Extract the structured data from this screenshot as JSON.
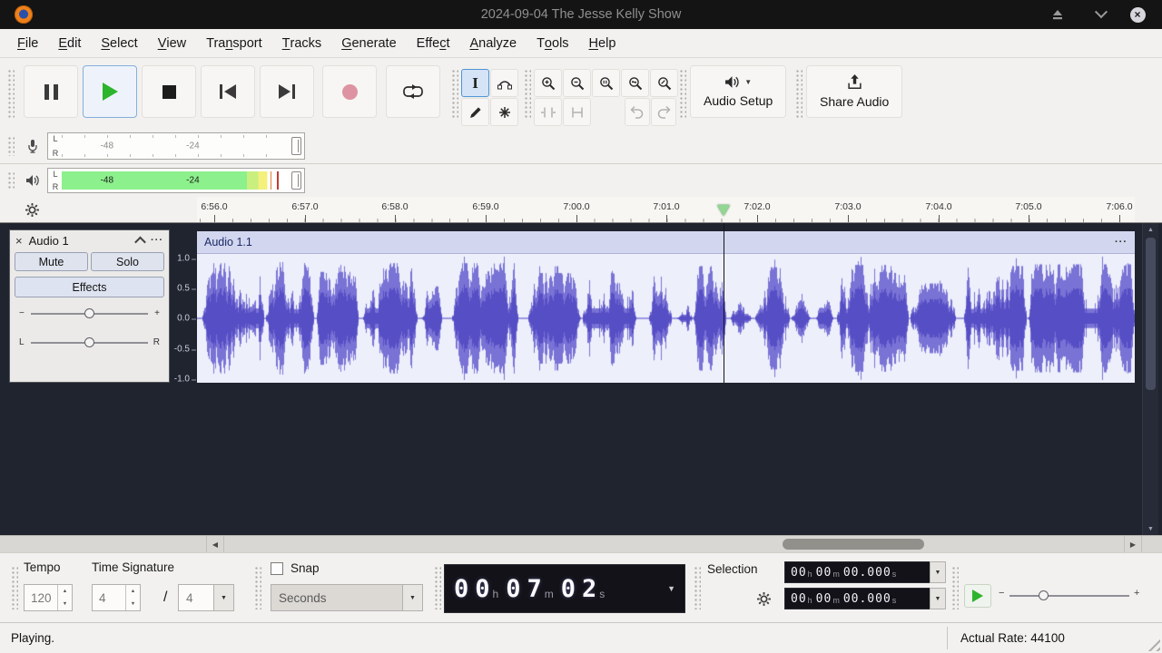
{
  "window": {
    "title": "2024-09-04 The Jesse Kelly Show"
  },
  "menu": {
    "items": [
      {
        "pre": "",
        "key": "F",
        "post": "ile"
      },
      {
        "pre": "",
        "key": "E",
        "post": "dit"
      },
      {
        "pre": "",
        "key": "S",
        "post": "elect"
      },
      {
        "pre": "",
        "key": "V",
        "post": "iew"
      },
      {
        "pre": "Tra",
        "key": "n",
        "post": "sport"
      },
      {
        "pre": "",
        "key": "T",
        "post": "racks"
      },
      {
        "pre": "",
        "key": "G",
        "post": "enerate"
      },
      {
        "pre": "Effe",
        "key": "c",
        "post": "t"
      },
      {
        "pre": "",
        "key": "A",
        "post": "nalyze"
      },
      {
        "pre": "T",
        "key": "o",
        "post": "ols"
      },
      {
        "pre": "",
        "key": "H",
        "post": "elp"
      }
    ]
  },
  "toolbar": {
    "audio_setup_label": "Audio Setup",
    "share_audio_label": "Share Audio"
  },
  "meters": {
    "record": {
      "l": "L",
      "r": "R"
    },
    "playback": {
      "l": "L",
      "r": "R"
    },
    "scale": [
      "-48",
      "-24"
    ]
  },
  "timeline": {
    "ticks": [
      "6:56.0",
      "6:57.0",
      "6:58.0",
      "6:59.0",
      "7:00.0",
      "7:01.0",
      "7:02.0",
      "7:03.0",
      "7:04.0",
      "7:05.0",
      "7:06.0"
    ]
  },
  "track": {
    "name": "Audio 1",
    "mute_label": "Mute",
    "solo_label": "Solo",
    "effects_label": "Effects",
    "gain_min": "−",
    "gain_max": "+",
    "pan_left": "L",
    "pan_right": "R",
    "scale": [
      "1.0",
      "0.5",
      "0.0",
      "-0.5",
      "-1.0"
    ],
    "clip_name": "Audio 1.1"
  },
  "transport_time": {
    "h": "00",
    "unit_h": "h",
    "m": "07",
    "unit_m": "m",
    "s": "02",
    "unit_s": "s"
  },
  "selection": {
    "label": "Selection",
    "units": {
      "h": "h",
      "m": "m",
      "s": "s"
    },
    "rows": [
      {
        "h": "00",
        "m": "00",
        "s": "00.000"
      },
      {
        "h": "00",
        "m": "00",
        "s": "00.000"
      }
    ]
  },
  "bottom": {
    "tempo_label": "Tempo",
    "tempo_value": "120",
    "timesig_label": "Time Signature",
    "timesig_upper": "4",
    "timesig_divider": "/",
    "timesig_lower": "4",
    "snap_label": "Snap",
    "snap_value": "Seconds"
  },
  "status": {
    "left": "Playing.",
    "right": "Actual Rate: 44100"
  },
  "icons": {
    "caret_down": "▼",
    "caret_up": "▲",
    "arrow_left": "◀",
    "arrow_right": "▶",
    "ellipsis": "···",
    "close_track": "×",
    "titlebar_close": "×",
    "minus": "−",
    "plus": "+"
  },
  "colors": {
    "accent_selection": "#4f94d4",
    "play_green": "#2db42d",
    "record_pink": "#de93a2",
    "meter_green": "#8cf08c",
    "playhead_triangle": "#93d693"
  },
  "waveform": {
    "bg": "#edeffb",
    "color": "#7a73d6",
    "color_rms": "#564ec4",
    "playhead_frac": 0.5614,
    "segments": [
      [
        0.005,
        0.071,
        0.95
      ],
      [
        0.073,
        0.124,
        0.88
      ],
      [
        0.127,
        0.172,
        0.8
      ],
      [
        0.177,
        0.235,
        0.95
      ],
      [
        0.24,
        0.261,
        0.55
      ],
      [
        0.272,
        0.342,
        0.95
      ],
      [
        0.353,
        0.409,
        0.78
      ],
      [
        0.411,
        0.468,
        0.95
      ],
      [
        0.482,
        0.506,
        0.85
      ],
      [
        0.512,
        0.528,
        0.35
      ],
      [
        0.529,
        0.564,
        0.9
      ],
      [
        0.569,
        0.591,
        0.42
      ],
      [
        0.595,
        0.632,
        0.88
      ],
      [
        0.634,
        0.654,
        0.52
      ],
      [
        0.66,
        0.678,
        0.28
      ],
      [
        0.682,
        0.758,
        0.92
      ],
      [
        0.76,
        0.809,
        0.6
      ],
      [
        0.818,
        0.884,
        0.9
      ],
      [
        0.886,
        1.0,
        0.93
      ]
    ]
  }
}
